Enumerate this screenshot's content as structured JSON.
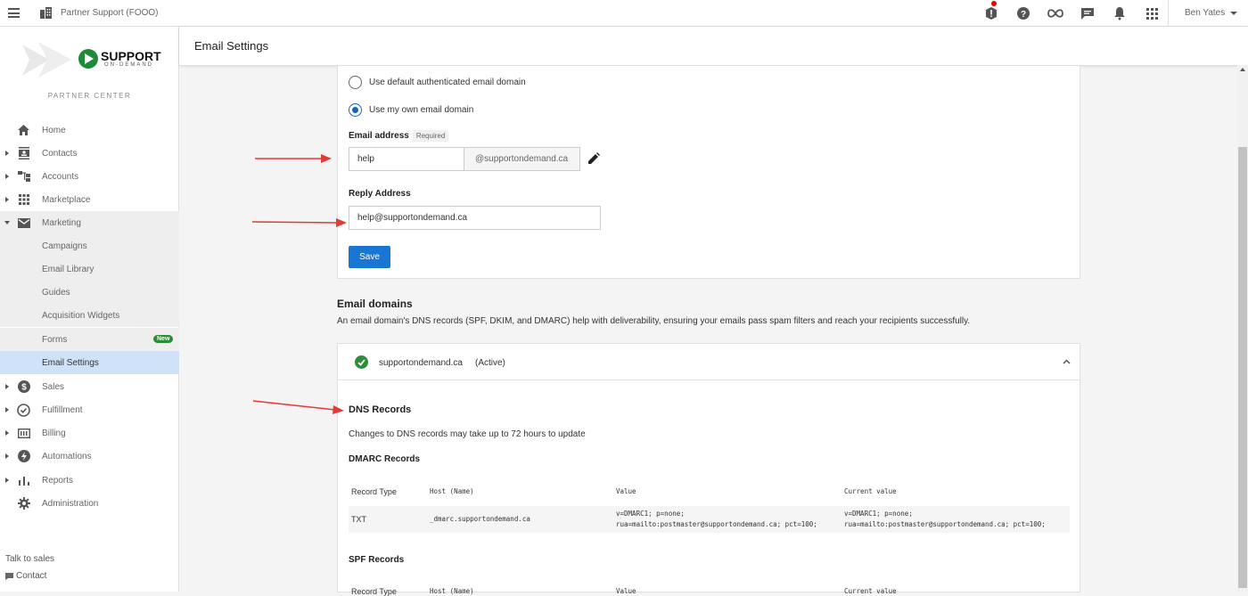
{
  "topbar": {
    "org_name": "Partner Support (FOOO)",
    "user_name": "Ben Yates",
    "icons": [
      "alert-icon",
      "help-icon",
      "infinity-icon",
      "chat-icon",
      "bell-icon",
      "apps-grid-icon"
    ]
  },
  "sidebar": {
    "logo_text": "SUPPORT",
    "logo_subtext": "ON-DEMAND",
    "partner_center": "PARTNER CENTER",
    "items": [
      {
        "label": "Home",
        "icon": "home-icon"
      },
      {
        "label": "Contacts",
        "icon": "contacts-icon"
      },
      {
        "label": "Accounts",
        "icon": "accounts-icon"
      },
      {
        "label": "Marketplace",
        "icon": "marketplace-icon"
      },
      {
        "label": "Marketing",
        "icon": "mail-icon"
      },
      {
        "label": "Campaigns"
      },
      {
        "label": "Email Library"
      },
      {
        "label": "Guides"
      },
      {
        "label": "Acquisition Widgets"
      },
      {
        "label": "Forms",
        "badge": "New"
      },
      {
        "label": "Email Settings"
      },
      {
        "label": "Sales",
        "icon": "dollar-icon"
      },
      {
        "label": "Fulfillment",
        "icon": "check-circle-icon"
      },
      {
        "label": "Billing",
        "icon": "billing-icon"
      },
      {
        "label": "Automations",
        "icon": "bolt-icon"
      },
      {
        "label": "Reports",
        "icon": "bar-chart-icon"
      },
      {
        "label": "Administration",
        "icon": "gear-icon"
      }
    ],
    "talk_to_sales": "Talk to sales",
    "contact": "Contact"
  },
  "header": {
    "title": "Email Settings"
  },
  "sender": {
    "option_default": "Use default authenticated email domain",
    "option_own": "Use my own email domain",
    "email_label": "Email address",
    "required_badge": "Required",
    "email_value": "help",
    "email_suffix": "@supportondemand.ca",
    "reply_label": "Reply Address",
    "reply_value": "help@supportondemand.ca",
    "save_label": "Save"
  },
  "domains": {
    "title": "Email domains",
    "description": "An email domain's DNS records (SPF, DKIM, and DMARC) help with deliverability, ensuring your emails pass spam filters and reach your recipients successfully.",
    "domain_name": "supportondemand.ca",
    "domain_status": "(Active)",
    "dns_title": "DNS Records",
    "dns_note": "Changes to DNS records may take up to 72 hours to update",
    "dmarc_title": "DMARC Records",
    "spf_title": "SPF Records",
    "columns": [
      "Record Type",
      "Host (Name)",
      "Value",
      "Current value"
    ],
    "dmarc_row": {
      "type": "TXT",
      "host": "_dmarc.supportondemand.ca",
      "value_line1": "v=DMARC1; p=none;",
      "value_line2": "rua=mailto:postmaster@supportondemand.ca; pct=100;",
      "current_line1": "v=DMARC1; p=none;",
      "current_line2": "rua=mailto:postmaster@supportondemand.ca; pct=100;"
    }
  },
  "colors": {
    "primary": "#1976d2",
    "success": "#2e8b3a",
    "annotation_arrow": "#e53935",
    "active_nav": "#cfe2f7"
  }
}
